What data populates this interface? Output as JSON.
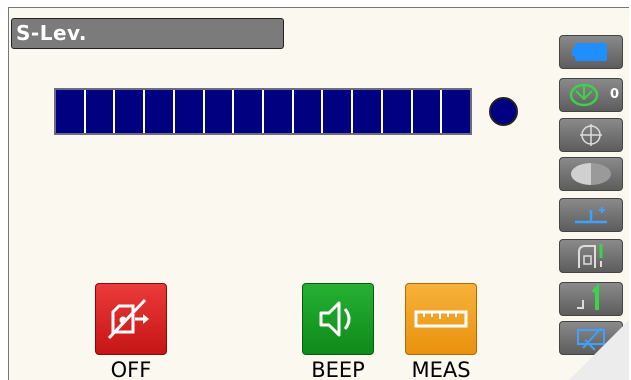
{
  "screen": {
    "title": "S-Lev."
  },
  "level_bar": {
    "segments": 14
  },
  "sidebar": {
    "battery_icon": "battery-icon",
    "tilt_value": "0",
    "items": [
      "battery-icon",
      "tilt-compensation-icon",
      "target-icon",
      "half-circle-icon",
      "height-offset-icon",
      "laser-plummet-icon",
      "level-1-icon",
      "pointer-icon"
    ]
  },
  "softkeys": {
    "off_label": "OFF",
    "beep_label": "BEEP",
    "meas_label": "MEAS"
  },
  "colors": {
    "level_fill": "#000080",
    "off": "#d62020",
    "beep": "#169a22",
    "meas": "#f0a020",
    "side_button": "#6f6f6f"
  }
}
